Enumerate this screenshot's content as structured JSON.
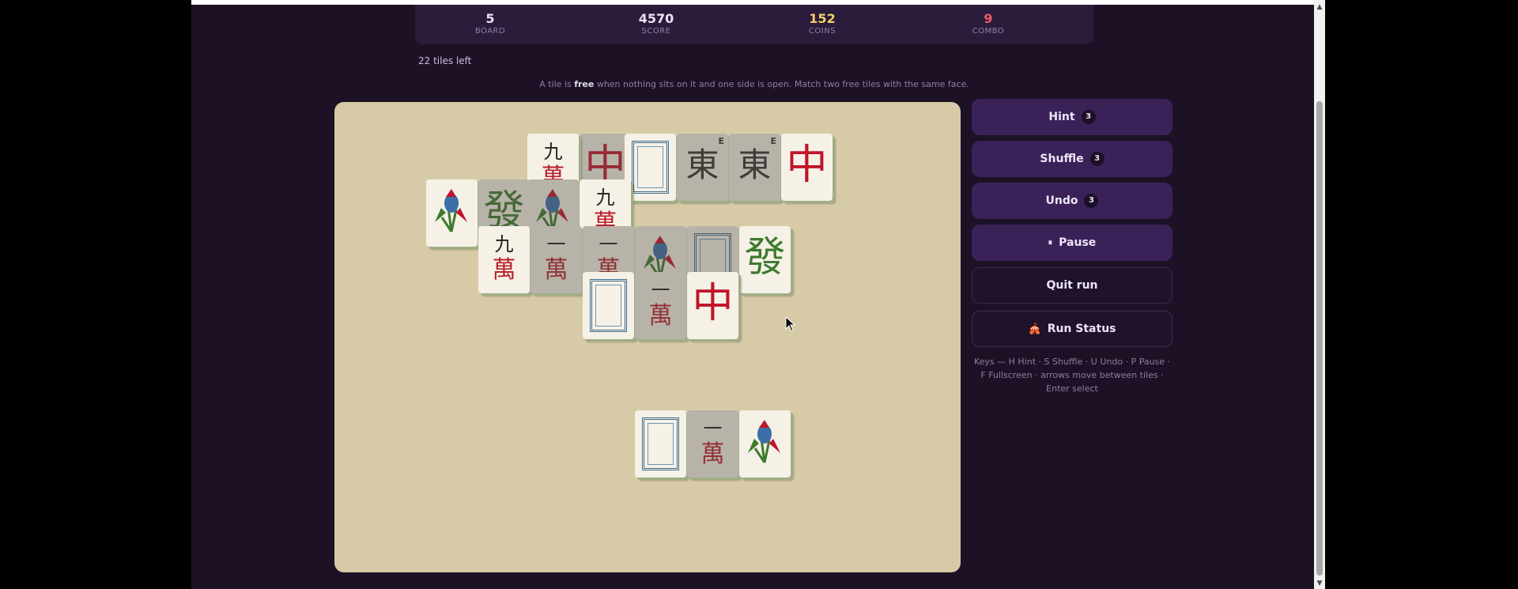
{
  "stats": [
    {
      "value": "5",
      "label": "BOARD",
      "color": "#eae2f4"
    },
    {
      "value": "4570",
      "label": "SCORE",
      "color": "#eae2f4"
    },
    {
      "value": "152",
      "label": "COINS",
      "color": "#f2cf6a"
    },
    {
      "value": "9",
      "label": "COMBO",
      "color": "#f0596a"
    }
  ],
  "tiles_left": "22 tiles left",
  "instructions": {
    "prefix": "A tile is ",
    "emphasis": "free",
    "suffix": " when nothing sits on it and one side is open. Match two free tiles with the same face."
  },
  "tiles": {
    "nine_wan": {
      "top": "九",
      "bottom": "萬"
    },
    "one_wan": {
      "top": "一",
      "bottom": "萬"
    },
    "red_dragon": "中",
    "green_dragon": "發",
    "east_wind": "東",
    "east_corner": "E",
    "bamboo_bird": "bird-icon",
    "white_dragon": "frame-icon"
  },
  "buttons": {
    "hint": {
      "label": "Hint",
      "count": "3"
    },
    "shuffle": {
      "label": "Shuffle",
      "count": "3"
    },
    "undo": {
      "label": "Undo",
      "count": "3"
    },
    "pause": {
      "label": "Pause",
      "icon": "⏸"
    },
    "quit": {
      "label": "Quit run"
    },
    "run_status": {
      "label": "Run Status",
      "icon": "🎪"
    }
  },
  "keys_help": "Keys — H Hint · S Shuffle · U Undo · P Pause · F Fullscreen · arrows move between tiles · Enter select",
  "colors": {
    "accent": "#3a2258",
    "background": "#1d1126",
    "board": "#d7cba7",
    "tile": "#f6f1e6",
    "coins": "#f2cf6a",
    "combo": "#f0596a"
  }
}
